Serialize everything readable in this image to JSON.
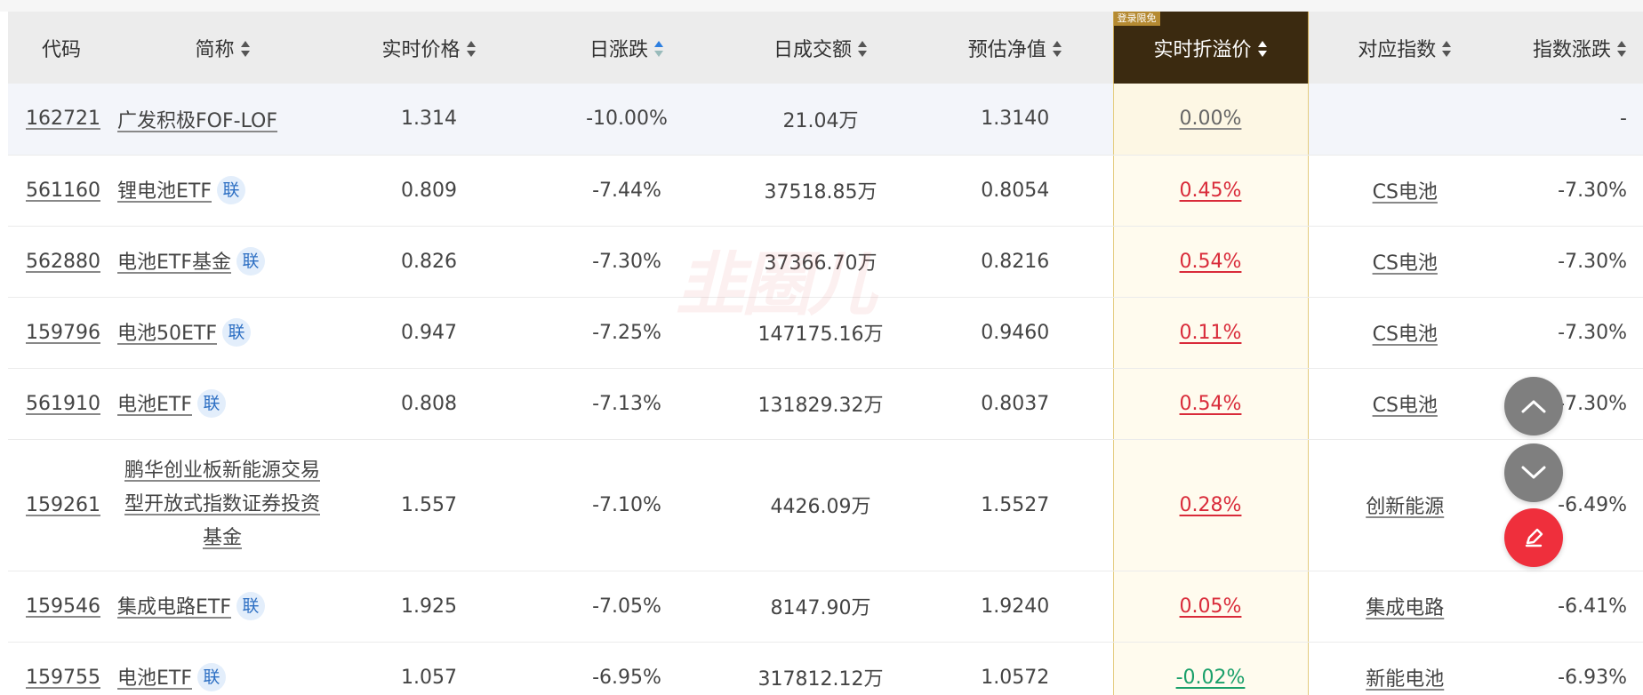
{
  "headers": {
    "code": "代码",
    "name": "简称",
    "price": "实时价格",
    "day_change": "日涨跌",
    "volume": "日成交额",
    "nav": "预估净值",
    "premium": "实时折溢价",
    "premium_badge": "登录限免",
    "index": "对应指数",
    "index_change": "指数涨跌"
  },
  "lian_label": "联",
  "watermark": "韭圈儿",
  "rows": [
    {
      "code": "162721",
      "name": "广发积极FOF-LOF",
      "price": "1.314",
      "change": "-10.00%",
      "volume": "21.04万",
      "nav": "1.3140",
      "premium": "0.00%",
      "index": "",
      "index_change": "-"
    },
    {
      "code": "561160",
      "name": "锂电池ETF",
      "price": "0.809",
      "change": "-7.44%",
      "volume": "37518.85万",
      "nav": "0.8054",
      "premium": "0.45%",
      "index": "CS电池",
      "index_change": "-7.30%"
    },
    {
      "code": "562880",
      "name": "电池ETF基金",
      "price": "0.826",
      "change": "-7.30%",
      "volume": "37366.70万",
      "nav": "0.8216",
      "premium": "0.54%",
      "index": "CS电池",
      "index_change": "-7.30%"
    },
    {
      "code": "159796",
      "name": "电池50ETF",
      "price": "0.947",
      "change": "-7.25%",
      "volume": "147175.16万",
      "nav": "0.9460",
      "premium": "0.11%",
      "index": "CS电池",
      "index_change": "-7.30%"
    },
    {
      "code": "561910",
      "name": "电池ETF",
      "price": "0.808",
      "change": "-7.13%",
      "volume": "131829.32万",
      "nav": "0.8037",
      "premium": "0.54%",
      "index": "CS电池",
      "index_change": "-7.30%"
    },
    {
      "code": "159261",
      "name": "鹏华创业板新能源交易型开放式指数证券投资基金",
      "price": "1.557",
      "change": "-7.10%",
      "volume": "4426.09万",
      "nav": "1.5527",
      "premium": "0.28%",
      "index": "创新能源",
      "index_change": "-6.49%"
    },
    {
      "code": "159546",
      "name": "集成电路ETF",
      "price": "1.925",
      "change": "-7.05%",
      "volume": "8147.90万",
      "nav": "1.9240",
      "premium": "0.05%",
      "index": "集成电路",
      "index_change": "-6.41%"
    },
    {
      "code": "159755",
      "name": "电池ETF",
      "price": "1.057",
      "change": "-6.95%",
      "volume": "317812.12万",
      "nav": "1.0572",
      "premium": "-0.02%",
      "index": "新能电池",
      "index_change": "-6.93%"
    }
  ]
}
